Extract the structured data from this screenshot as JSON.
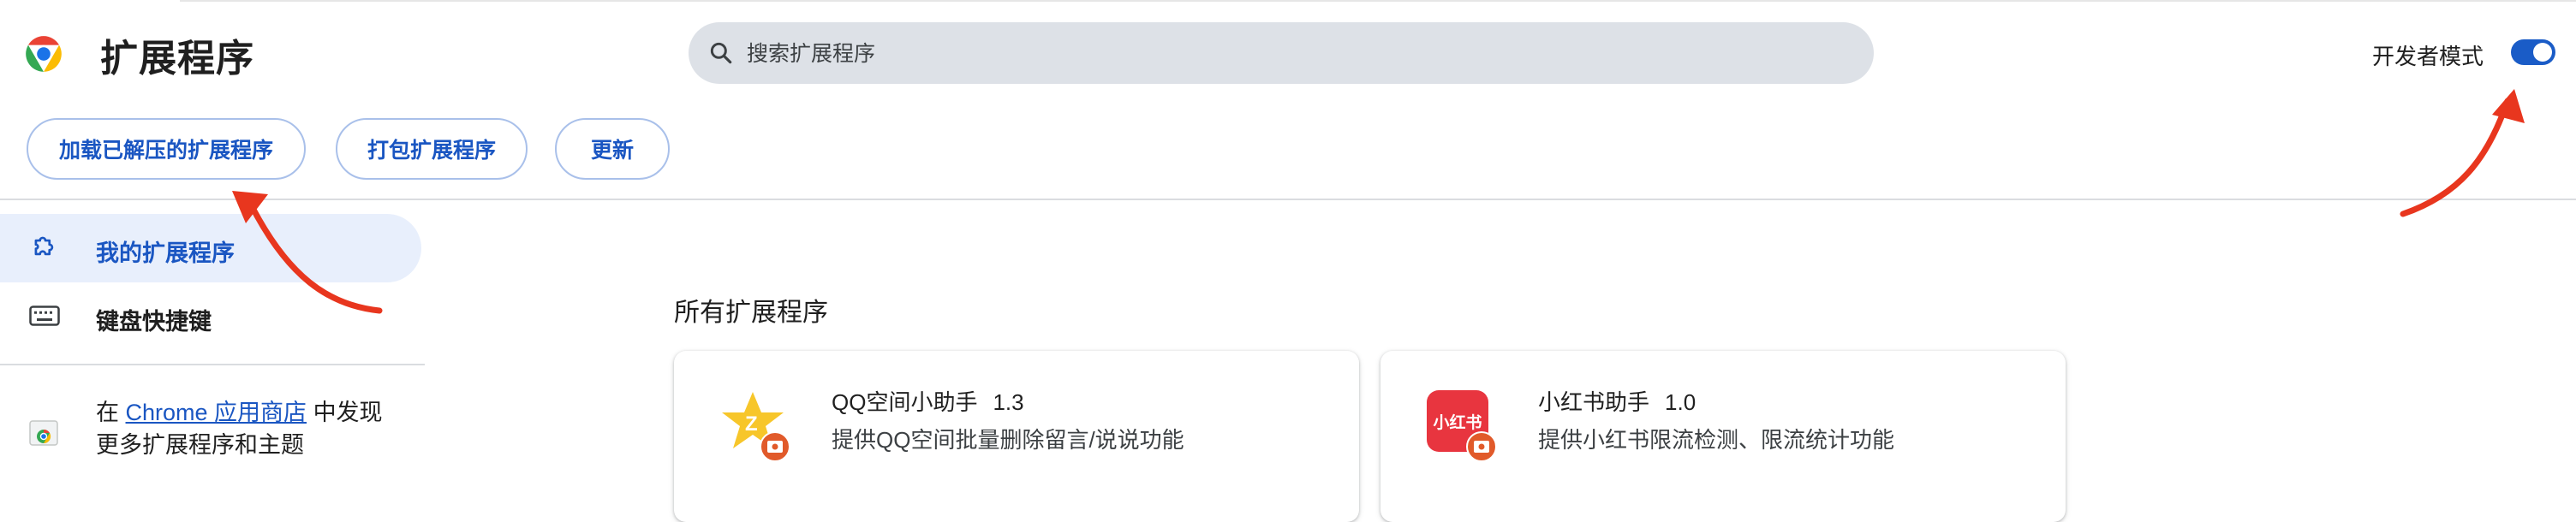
{
  "header": {
    "title": "扩展程序",
    "search_placeholder": "搜索扩展程序",
    "dev_mode_label": "开发者模式",
    "dev_mode_on": true,
    "chrome_logo_icon": "chrome-logo-icon",
    "search_icon": "search-icon"
  },
  "toolbar": {
    "load_unpacked": "加载已解压的扩展程序",
    "pack": "打包扩展程序",
    "update": "更新"
  },
  "sidebar": {
    "items": [
      {
        "label": "我的扩展程序",
        "icon": "puzzle-piece-icon",
        "active": true
      },
      {
        "label": "键盘快捷键",
        "icon": "keyboard-icon",
        "active": false
      }
    ],
    "promo": {
      "prefix": "在",
      "link": "Chrome 应用商店",
      "suffix": "中发现",
      "line2": "更多扩展程序和主题"
    }
  },
  "main": {
    "section_title": "所有扩展程序",
    "extensions": [
      {
        "name": "QQ空间小助手",
        "version": "1.3",
        "description": "提供QQ空间批量删除留言/说说功能",
        "icon": "qq-zone-icon"
      },
      {
        "name": "小红书助手",
        "version": "1.0",
        "description": "提供小红书限流检测、限流统计功能",
        "icon": "xiaohongshu-icon",
        "icon_text": "小红书"
      }
    ]
  },
  "colors": {
    "accent": "#1a56c2",
    "search_bg": "#dde1e7",
    "nav_active_bg": "#e8effc",
    "annotation_arrow": "#e8361e"
  }
}
